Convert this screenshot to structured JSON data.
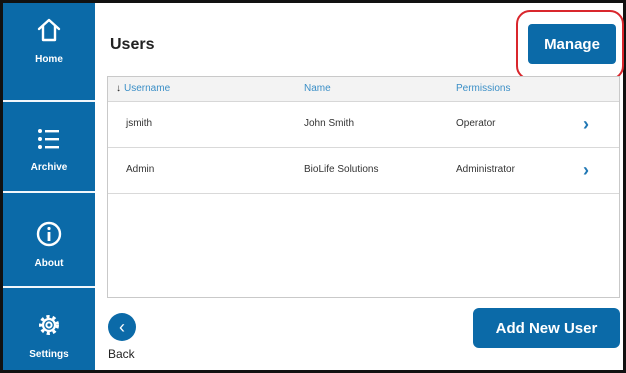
{
  "colors": {
    "primary": "#0b6aa8",
    "highlight": "#d9262c",
    "header_text": "#3b8fc7"
  },
  "sidebar": {
    "items": [
      {
        "label": "Home",
        "icon": "home-icon"
      },
      {
        "label": "Archive",
        "icon": "list-icon"
      },
      {
        "label": "About",
        "icon": "info-icon"
      },
      {
        "label": "Settings",
        "icon": "gear-icon"
      }
    ]
  },
  "page": {
    "title": "Users"
  },
  "toolbar": {
    "manage_label": "Manage"
  },
  "table": {
    "sort_indicator": "↓",
    "headers": [
      "Username",
      "Name",
      "Permissions"
    ],
    "rows": [
      {
        "username": "jsmith",
        "name": "John Smith",
        "permissions": "Operator"
      },
      {
        "username": "Admin",
        "name": "BioLife Solutions",
        "permissions": "Administrator"
      }
    ]
  },
  "footer": {
    "back_label": "Back",
    "back_icon": "chevron-left-icon",
    "add_user_label": "Add New User"
  }
}
